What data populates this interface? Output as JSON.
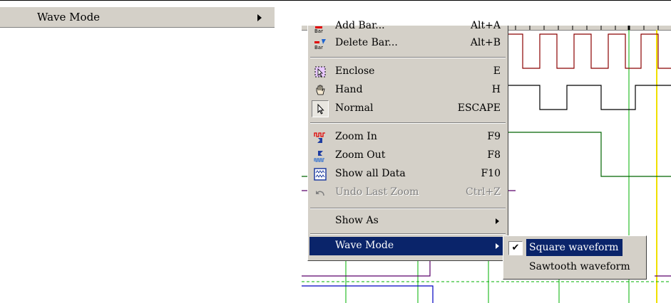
{
  "left_menu": {
    "wave_mode_label": "Wave Mode"
  },
  "context_menu": {
    "partial_top_label": "Add Bar...",
    "partial_top_key": "Alt+A",
    "items": [
      {
        "label": "Delete Bar...",
        "shortcut": "Alt+B",
        "icon": "delete-bar-icon"
      },
      {
        "label": "Enclose",
        "shortcut": "E",
        "icon": "enclose-icon"
      },
      {
        "label": "Hand",
        "shortcut": "H",
        "icon": "hand-icon"
      },
      {
        "label": "Normal",
        "shortcut": "ESCAPE",
        "icon": "pointer-icon"
      },
      {
        "label": "Zoom In",
        "shortcut": "F9",
        "icon": "zoom-in-icon"
      },
      {
        "label": "Zoom Out",
        "shortcut": "F8",
        "icon": "zoom-out-icon"
      },
      {
        "label": "Show all Data",
        "shortcut": "F10",
        "icon": "show-all-data-icon"
      },
      {
        "label": "Undo Last Zoom",
        "shortcut": "Ctrl+Z",
        "icon": "undo-zoom-icon",
        "disabled": true
      },
      {
        "label": "Show As",
        "submenu": true
      },
      {
        "label": "Wave Mode",
        "submenu": true,
        "highlighted": true
      }
    ]
  },
  "submenu": {
    "items": [
      {
        "label": "Square waveform",
        "checked": true,
        "highlighted": true
      },
      {
        "label": "Sawtooth waveform",
        "checked": false
      }
    ],
    "check_glyph": "✔"
  },
  "colors": {
    "menu_bg": "#d4d0c8",
    "highlight": "#0a246a",
    "wave_red": "#8b0000",
    "wave_green": "#006400",
    "wave_purple": "#5a006a",
    "grid_green": "#00b000",
    "marker_yellow": "#f0e000",
    "wave_blue": "#0000c0"
  }
}
